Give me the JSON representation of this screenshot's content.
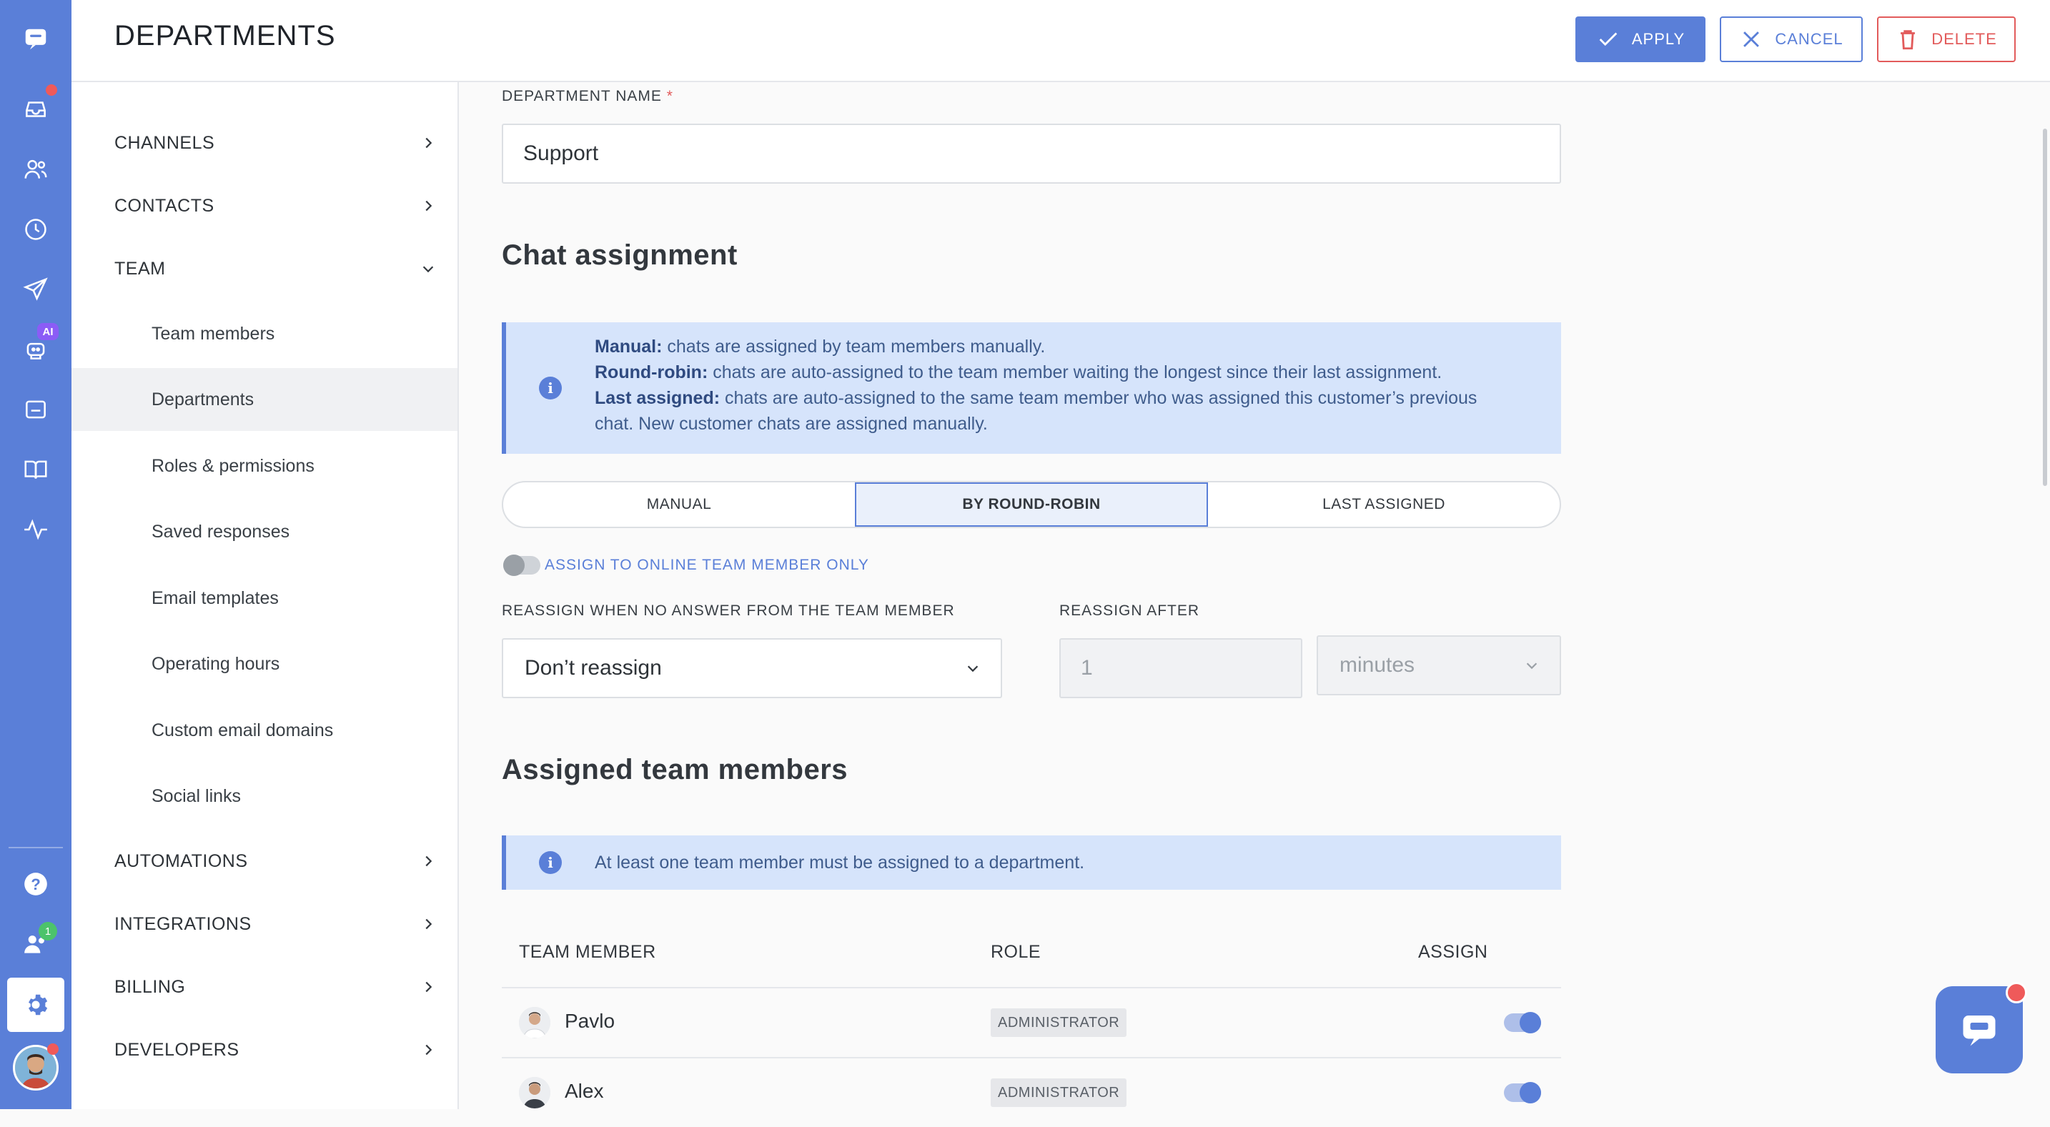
{
  "header": {
    "title": "DEPARTMENTS",
    "apply_label": "APPLY",
    "cancel_label": "CANCEL",
    "delete_label": "DELETE"
  },
  "rail": {
    "icons": [
      "chat-logo-icon",
      "inbox-icon",
      "contacts-icon",
      "history-icon",
      "send-icon",
      "ai-bot-icon",
      "widget-icon",
      "knowledge-base-icon",
      "analytics-icon",
      "help-icon",
      "team-icon",
      "settings-icon",
      "user-avatar"
    ],
    "ai_badge": "AI",
    "team_badge": "1"
  },
  "sidebar": {
    "sections": [
      {
        "label": "CHANNELS"
      },
      {
        "label": "CONTACTS"
      },
      {
        "label": "TEAM"
      },
      {
        "label": "AUTOMATIONS"
      },
      {
        "label": "INTEGRATIONS"
      },
      {
        "label": "BILLING"
      },
      {
        "label": "DEVELOPERS"
      }
    ],
    "team_items": [
      {
        "label": "Team members"
      },
      {
        "label": "Departments"
      },
      {
        "label": "Roles & permissions"
      },
      {
        "label": "Saved responses"
      },
      {
        "label": "Email templates"
      },
      {
        "label": "Operating hours"
      },
      {
        "label": "Custom email domains"
      },
      {
        "label": "Social links"
      }
    ]
  },
  "form": {
    "name_label": "DEPARTMENT NAME",
    "required_mark": "*",
    "name_value": "Support",
    "chat_assignment_title": "Chat assignment",
    "info": {
      "manual_term": "Manual:",
      "manual_text": " chats are assigned by team members manually.",
      "rr_term": "Round-robin:",
      "rr_text": " chats are auto-assigned to the team member waiting the longest since their last assignment.",
      "last_term": "Last assigned:",
      "last_text": " chats are auto-assigned to the same team member who was assigned this customer’s previous",
      "last_text2": "chat. New customer chats are assigned manually."
    },
    "modes": [
      {
        "label": "MANUAL"
      },
      {
        "label": "BY ROUND-ROBIN"
      },
      {
        "label": "LAST ASSIGNED"
      }
    ],
    "selected_mode": "BY ROUND-ROBIN",
    "online_only_label": "ASSIGN TO ONLINE TEAM MEMBER ONLY",
    "online_only_enabled": false,
    "reassign_label": "REASSIGN WHEN NO ANSWER FROM THE TEAM MEMBER",
    "reassign_value": "Don’t reassign",
    "reassign_after_label": "REASSIGN AFTER",
    "reassign_after_value": "1",
    "reassign_unit": "minutes"
  },
  "members": {
    "title": "Assigned team members",
    "notice": "At least one team member must be assigned to a department.",
    "columns": [
      "TEAM MEMBER",
      "ROLE",
      "ASSIGN"
    ],
    "rows": [
      {
        "name": "Pavlo",
        "role": "ADMINISTRATOR",
        "assigned": true
      },
      {
        "name": "Alex",
        "role": "ADMINISTRATOR",
        "assigned": true
      }
    ]
  },
  "colors": {
    "accent": "#5a7fd8",
    "danger": "#e25b5b",
    "info_bg": "#d6e4fb"
  }
}
